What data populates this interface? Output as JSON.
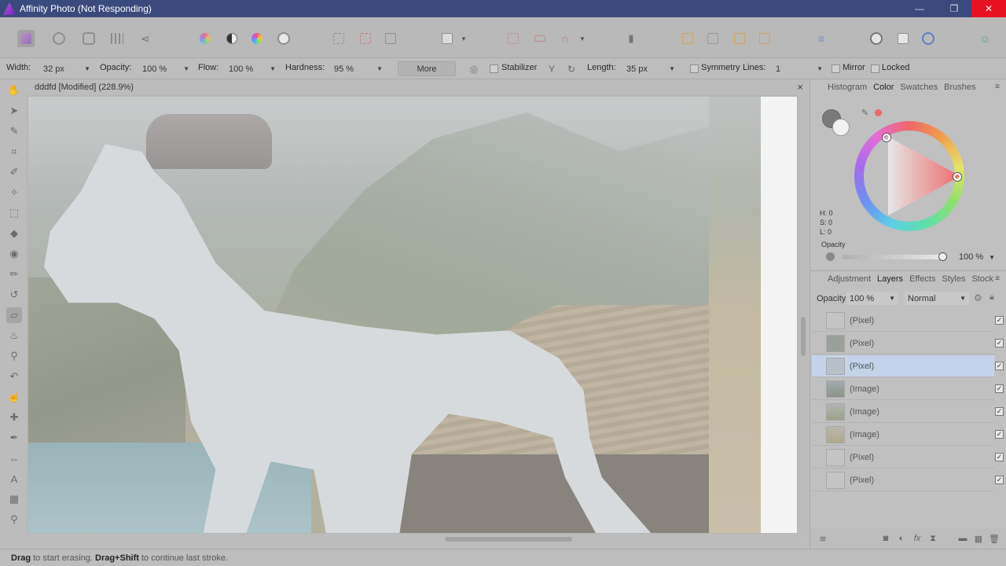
{
  "window": {
    "title": "Affinity Photo (Not Responding)",
    "controls": {
      "minimize": "—",
      "maximize": "❐",
      "close": "✕"
    }
  },
  "context_toolbar": {
    "width_label": "Width:",
    "width_value": "32 px",
    "opacity_label": "Opacity:",
    "opacity_value": "100 %",
    "flow_label": "Flow:",
    "flow_value": "100 %",
    "hardness_label": "Hardness:",
    "hardness_value": "95 %",
    "more_label": "More",
    "stabilizer_label": "Stabilizer",
    "length_label": "Length:",
    "length_value": "35 px",
    "symmetry_label": "Symmetry",
    "lines_label": "Lines:",
    "lines_value": "1",
    "mirror_label": "Mirror",
    "locked_label": "Locked"
  },
  "document": {
    "tab_title": "dddfd [Modified] (228.9%)",
    "close": "×"
  },
  "color_panel": {
    "tabs": [
      "Histogram",
      "Color",
      "Swatches",
      "Brushes"
    ],
    "active_tab": "Color",
    "h": "H: 0",
    "s": "S: 0",
    "l": "L: 0",
    "opacity_label": "Opacity",
    "opacity_value": "100 %"
  },
  "layers_panel": {
    "tabs": [
      "Adjustment",
      "Layers",
      "Effects",
      "Styles",
      "Stock"
    ],
    "active_tab": "Layers",
    "opacity_label": "Opacity:",
    "opacity_value": "100 %",
    "blend_mode": "Normal",
    "layers": [
      {
        "name": "(Pixel)",
        "visible": "✓"
      },
      {
        "name": "(Pixel)",
        "visible": "✓"
      },
      {
        "name": "(Pixel)",
        "visible": "✓",
        "selected": true
      },
      {
        "name": "(Image)",
        "visible": "✓"
      },
      {
        "name": "(Image)",
        "visible": "✓"
      },
      {
        "name": "(Image)",
        "visible": "✓"
      },
      {
        "name": "(Pixel)",
        "visible": "✓"
      },
      {
        "name": "(Pixel)",
        "visible": "✓"
      }
    ]
  },
  "status": {
    "drag": "Drag",
    "text1": " to start erasing. ",
    "drag_shift": "Drag+Shift",
    "text2": " to continue last stroke."
  },
  "colors": {
    "titlebar": "#3b4a7c",
    "close_button": "#e81123",
    "selected_layer": "#c4d3ea"
  }
}
